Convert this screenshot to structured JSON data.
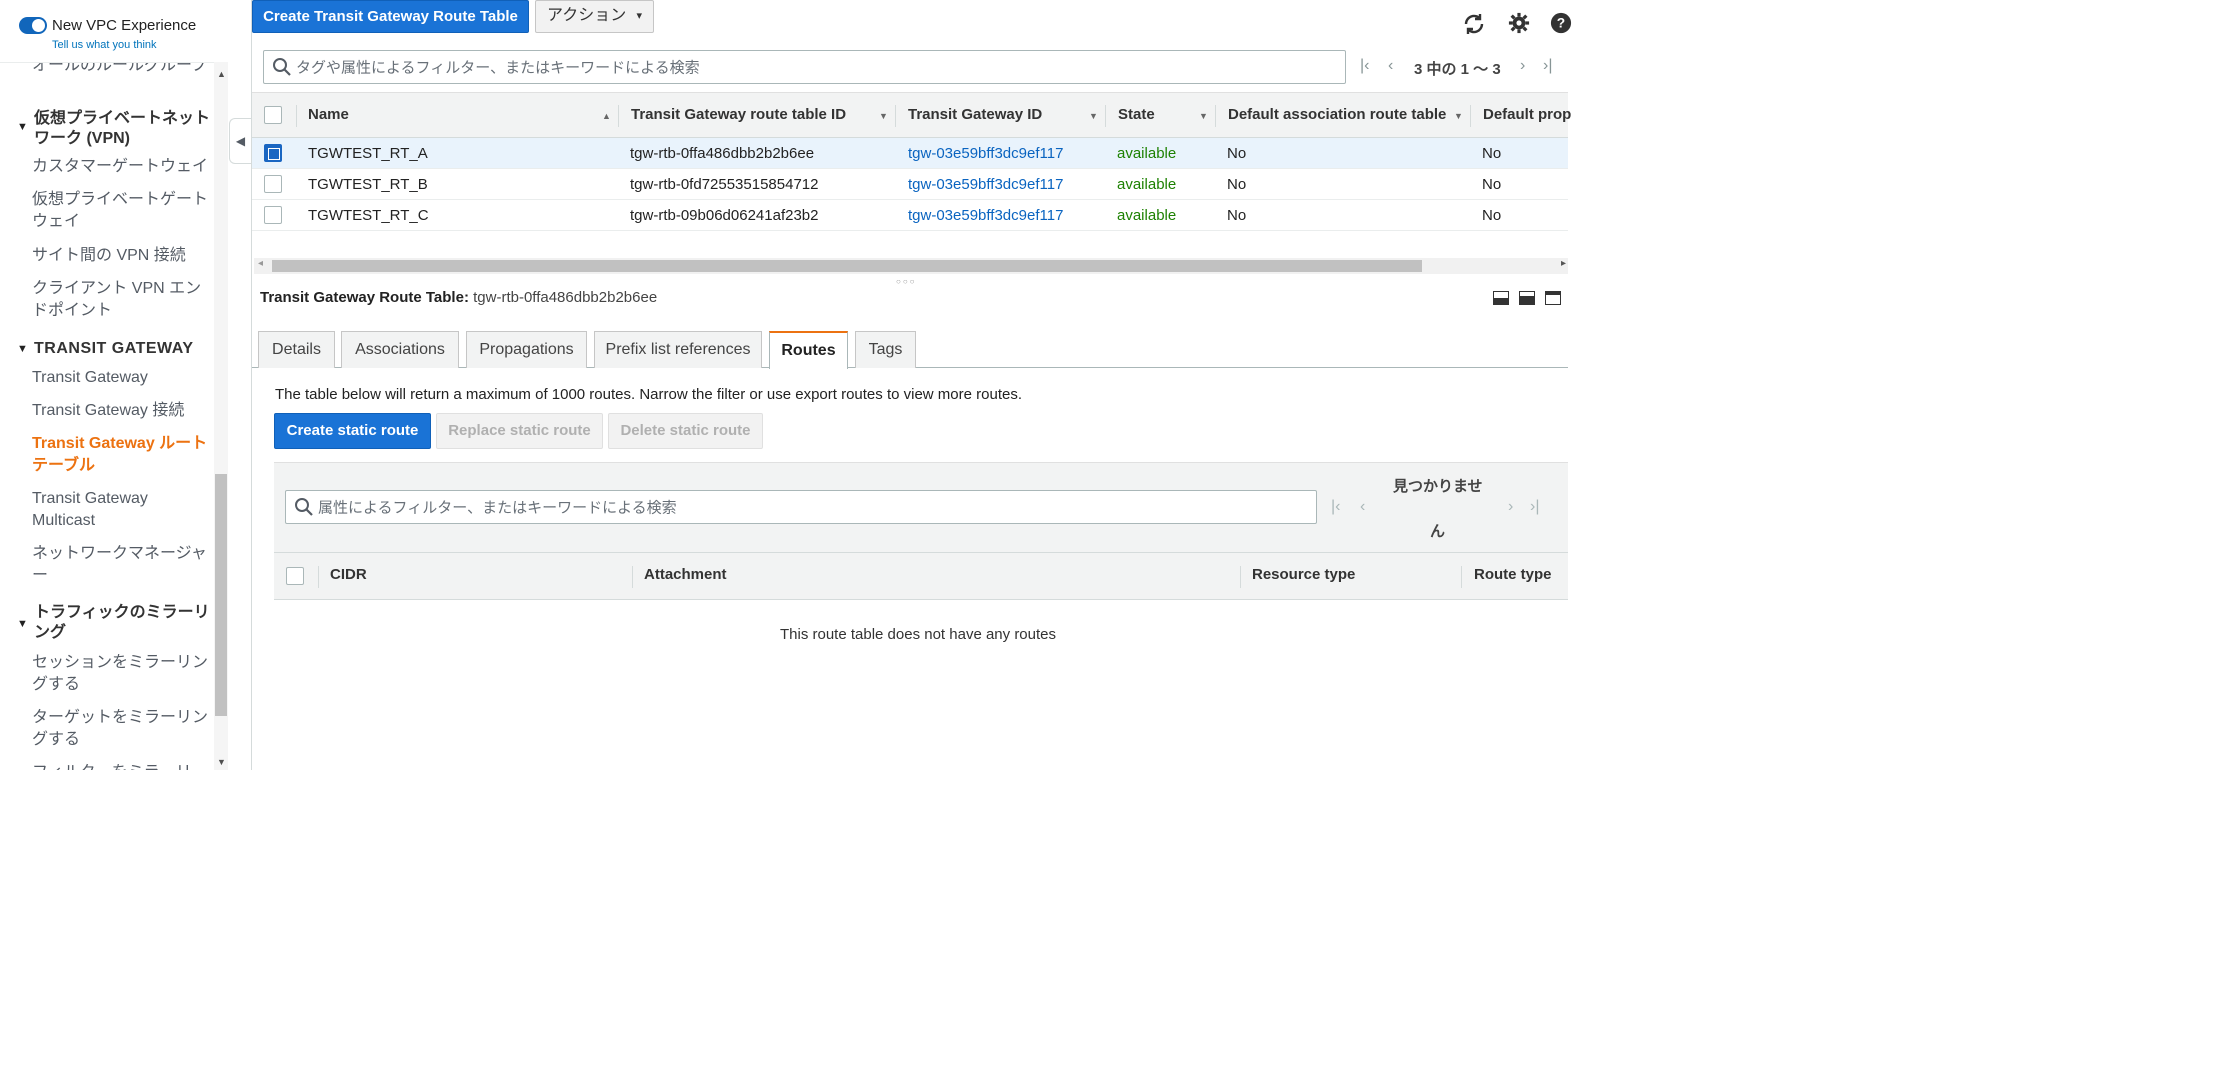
{
  "vpc_experience": {
    "title": "New VPC Experience",
    "feedback_link": "Tell us what you think"
  },
  "sidebar": {
    "items": [
      {
        "label": "オールのルールグループ",
        "type": "item"
      },
      {
        "label": "仮想プライベートネットワーク (VPN)",
        "type": "header"
      },
      {
        "label": "カスタマーゲートウェイ",
        "type": "item"
      },
      {
        "label": "仮想プライベートゲートウェイ",
        "type": "item"
      },
      {
        "label": "サイト間の VPN 接続",
        "type": "item"
      },
      {
        "label": "クライアント VPN エンドポイント",
        "type": "item"
      },
      {
        "label": "TRANSIT GATEWAY",
        "type": "header"
      },
      {
        "label": "Transit Gateway",
        "type": "item"
      },
      {
        "label": "Transit Gateway 接続",
        "type": "item"
      },
      {
        "label": "Transit Gateway ルートテーブル",
        "type": "item-active"
      },
      {
        "label": "Transit Gateway Multicast",
        "type": "item"
      },
      {
        "label": "ネットワークマネージャー",
        "type": "item"
      },
      {
        "label": "トラフィックのミラーリング",
        "type": "header"
      },
      {
        "label": "セッションをミラーリングする",
        "type": "item"
      },
      {
        "label": "ターゲットをミラーリングする",
        "type": "item"
      },
      {
        "label": "フィルターをミラーリ",
        "type": "item"
      }
    ]
  },
  "toolbar": {
    "create_button": "Create Transit Gateway Route Table",
    "actions_button": "アクション",
    "actions_chevron": "⌄",
    "icons": [
      "refresh-icon",
      "gear-icon",
      "help-icon"
    ]
  },
  "top_search": {
    "placeholder": "タグや属性によるフィルター、またはキーワードによる検索"
  },
  "top_pagination": {
    "text": "3 中の 1 ～ 3"
  },
  "main_table": {
    "columns": [
      "Name",
      "Transit Gateway route table ID",
      "Transit Gateway ID",
      "State",
      "Default association route table",
      "Default prop"
    ],
    "rows": [
      {
        "name": "TGWTEST_RT_A",
        "rtb_id": "tgw-rtb-0ffa486dbb2b2b6ee",
        "tgw_id": "tgw-03e59bff3dc9ef117",
        "state": "available",
        "default_assoc": "No",
        "default_prop": "No",
        "selected": true
      },
      {
        "name": "TGWTEST_RT_B",
        "rtb_id": "tgw-rtb-0fd72553515854712",
        "tgw_id": "tgw-03e59bff3dc9ef117",
        "state": "available",
        "default_assoc": "No",
        "default_prop": "No",
        "selected": false
      },
      {
        "name": "TGWTEST_RT_C",
        "rtb_id": "tgw-rtb-09b06d06241af23b2",
        "tgw_id": "tgw-03e59bff3dc9ef117",
        "state": "available",
        "default_assoc": "No",
        "default_prop": "No",
        "selected": false
      }
    ]
  },
  "detail": {
    "title_label": "Transit Gateway Route Table:",
    "title_value": "tgw-rtb-0ffa486dbb2b2b6ee",
    "tabs": [
      "Details",
      "Associations",
      "Propagations",
      "Prefix list references",
      "Routes",
      "Tags"
    ],
    "active_tab": "Routes"
  },
  "routes": {
    "info_text": "The table below will return a maximum of 1000 routes. Narrow the filter or use export routes to view more routes.",
    "create_button": "Create static route",
    "replace_button": "Replace static route",
    "delete_button": "Delete static route",
    "search_placeholder": "属性によるフィルター、またはキーワードによる検索",
    "pagination_text_line1": "見つかりませ",
    "pagination_text_line2": "ん",
    "columns": [
      "CIDR",
      "Attachment",
      "Resource type",
      "Route type"
    ],
    "empty_message": "This route table does not have any routes"
  },
  "colors": {
    "primary": "#1a73d6",
    "active_orange": "#ec7211",
    "link_blue": "#0a64c0",
    "status_green": "#1d8102"
  }
}
